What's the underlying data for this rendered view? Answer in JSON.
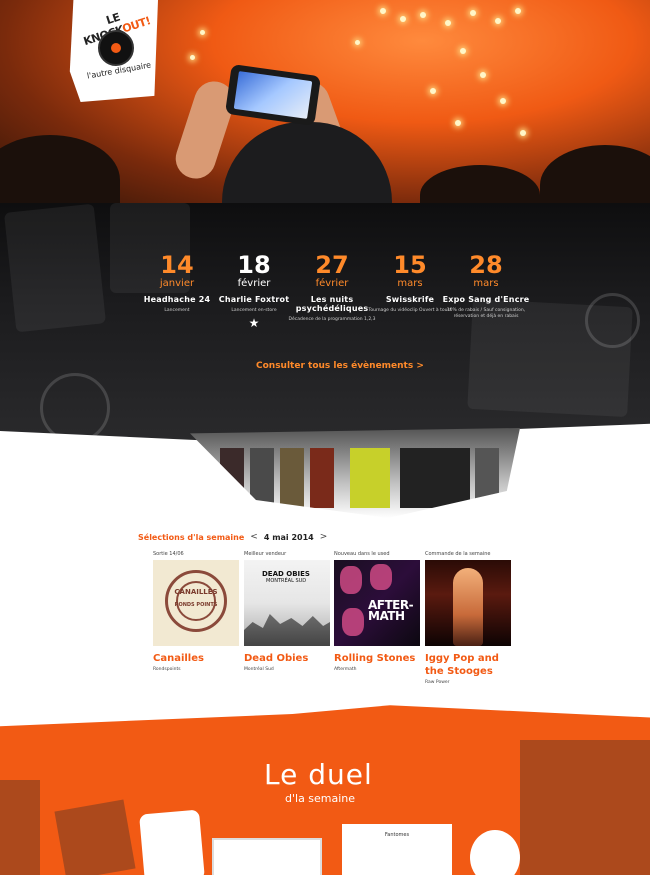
{
  "logo": {
    "name_part1": "LE KNOCK",
    "name_part2": "OUT!",
    "tagline": "l'autre disquaire"
  },
  "events": {
    "items": [
      {
        "day": "14",
        "month": "janvier",
        "name": "Headhache 24",
        "desc": "Lancement",
        "featured": false
      },
      {
        "day": "18",
        "month": "février",
        "name": "Charlie Foxtrot",
        "desc": "Lancement en-store",
        "featured": true
      },
      {
        "day": "27",
        "month": "février",
        "name": "Les nuits psychédéliques",
        "desc": "Décadence de la programmation 1,2,3",
        "featured": false
      },
      {
        "day": "15",
        "month": "mars",
        "name": "Swisskrife",
        "desc": "Tournage du vidéoclip Ouvert à tous!",
        "featured": false
      },
      {
        "day": "28",
        "month": "mars",
        "name": "Expo Sang d'Encre",
        "desc": "10% de rabais / Sauf consignation, réservation et déjà en rabais",
        "featured": false
      }
    ],
    "all_link": "Consulter tous les évènements  >"
  },
  "selections": {
    "label": "Sélections d'la semaine",
    "prev": "<",
    "date": "4 mai 2014",
    "next": ">",
    "albums": [
      {
        "kicker": "Sortie 14/06",
        "title": "Canailles",
        "sub": "Rondspoints",
        "cover": "canailles"
      },
      {
        "kicker": "Meilleur vendeur",
        "title": "Dead Obies",
        "sub": "Montréal Sud",
        "cover": "deadobies"
      },
      {
        "kicker": "Nouveau dans le used",
        "title": "Rolling Stones",
        "sub": "Aftermath",
        "cover": "aftermath"
      },
      {
        "kicker": "Commande de la semaine",
        "title": "Iggy Pop and the Stooges",
        "sub": "Raw Power",
        "cover": "iggy"
      }
    ],
    "cover_text": {
      "canailles": "CANAILLES",
      "canailles2": "RONDS POINTS",
      "deadobies1": "DEAD OBIES",
      "deadobies2": "MONTRÉAL SUD",
      "aftermath": "AFTER-MATH"
    }
  },
  "duel": {
    "title": "Le duel",
    "subtitle": "d'la semaine",
    "card_text": "Fantomes"
  },
  "colors": {
    "accent": "#f25a14",
    "accent_light": "#ff8a2a",
    "dark": "#111111"
  }
}
